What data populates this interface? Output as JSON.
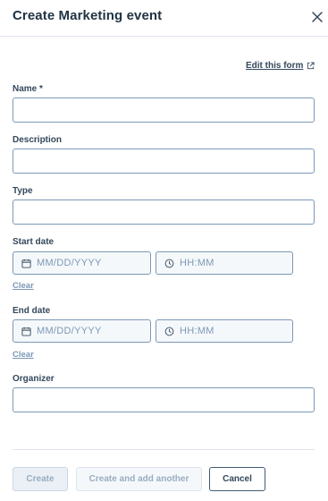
{
  "header": {
    "title": "Create Marketing event",
    "close_icon": "close-icon"
  },
  "edit_form": {
    "label": "Edit this form",
    "icon": "external-link-icon"
  },
  "fields": {
    "name": {
      "label": "Name *",
      "value": ""
    },
    "description": {
      "label": "Description",
      "value": ""
    },
    "type": {
      "label": "Type",
      "value": ""
    },
    "start_date": {
      "label": "Start date",
      "date_placeholder": "MM/DD/YYYY",
      "time_placeholder": "HH:MM",
      "clear": "Clear"
    },
    "end_date": {
      "label": "End date",
      "date_placeholder": "MM/DD/YYYY",
      "time_placeholder": "HH:MM",
      "clear": "Clear"
    },
    "organizer": {
      "label": "Organizer",
      "value": ""
    }
  },
  "footer": {
    "create": "Create",
    "create_another": "Create and add another",
    "cancel": "Cancel"
  },
  "colors": {
    "text": "#33475b",
    "border": "#7c98b6",
    "disabled_text": "#99acc2"
  }
}
